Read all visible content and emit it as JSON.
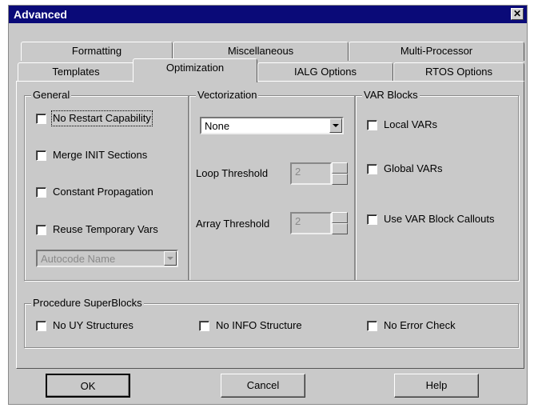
{
  "window": {
    "title": "Advanced",
    "close_glyph": "✕"
  },
  "tabs_back": [
    "Formatting",
    "Miscellaneous",
    "Multi-Processor"
  ],
  "tabs_front": [
    "Templates",
    "Optimization",
    "IALG Options",
    "RTOS Options"
  ],
  "active_tab": "Optimization",
  "general": {
    "legend": "General",
    "options": [
      "No Restart Capability",
      "Merge INIT Sections",
      "Constant Propagation",
      "Reuse Temporary Vars"
    ],
    "autocode_select": "Autocode Name"
  },
  "vectorization": {
    "legend": "Vectorization",
    "select_value": "None",
    "loop_label": "Loop Threshold",
    "loop_value": "2",
    "array_label": "Array Threshold",
    "array_value": "2"
  },
  "var_blocks": {
    "legend": "VAR Blocks",
    "options": [
      "Local VARs",
      "Global VARs",
      "Use VAR Block Callouts"
    ]
  },
  "procedure": {
    "legend": "Procedure SuperBlocks",
    "options": [
      "No UY Structures",
      "No INFO Structure",
      "No Error Check"
    ]
  },
  "buttons": {
    "ok": "OK",
    "cancel": "Cancel",
    "help": "Help"
  }
}
